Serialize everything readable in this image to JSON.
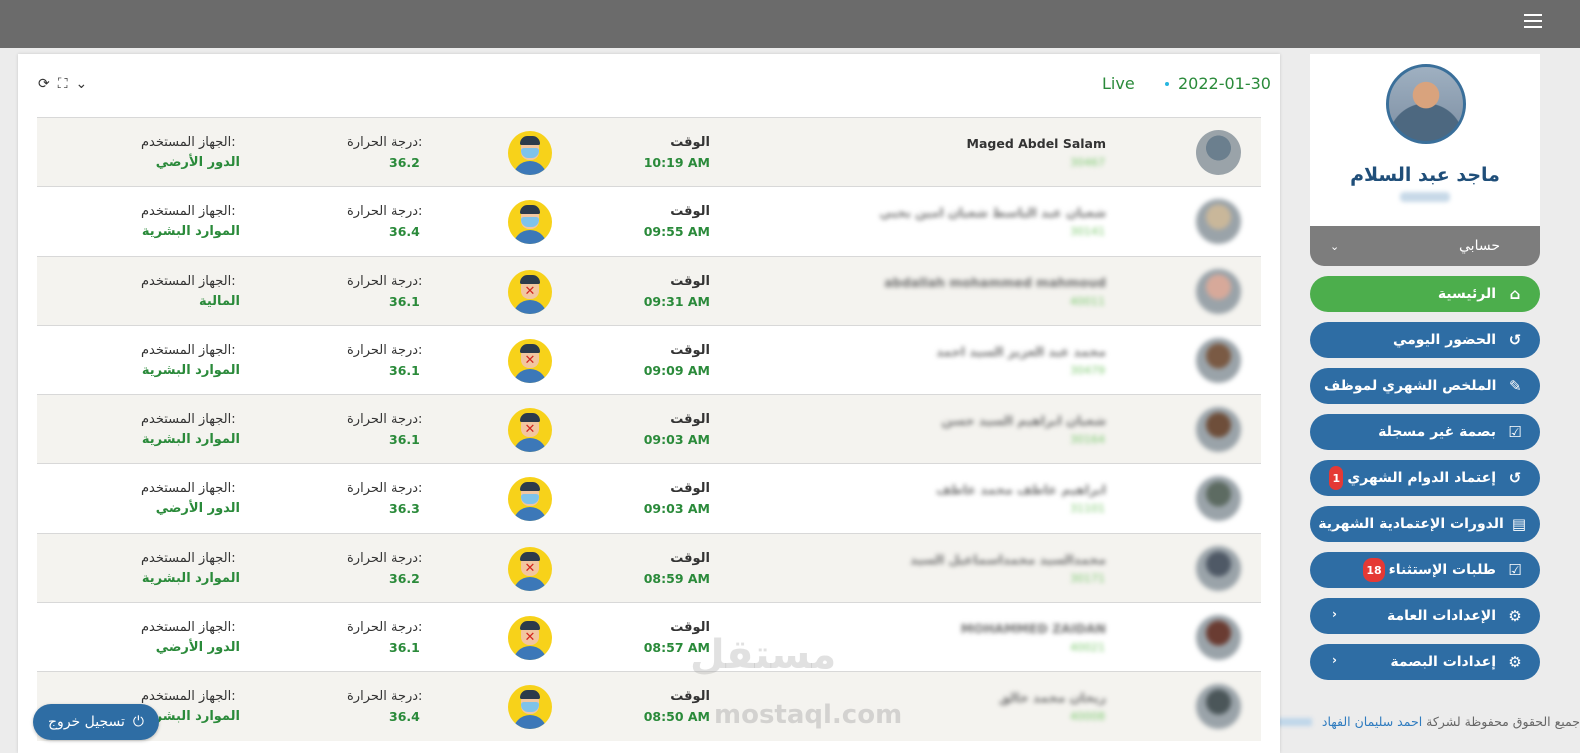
{
  "topbar": {
    "menu_icon": "hamburger-icon"
  },
  "profile": {
    "name": "ماجد عبد السلام",
    "account_label": "حسابي"
  },
  "menu": [
    {
      "label": "الرئيسية",
      "icon": "home-icon",
      "glyph": "⌂",
      "active": true
    },
    {
      "label": "الحضور اليومي",
      "icon": "history-icon",
      "glyph": "↺"
    },
    {
      "label": "الملخص الشهري لموظف",
      "icon": "document-edit-icon",
      "glyph": "✎"
    },
    {
      "label": "بصمة غير مسجلة",
      "icon": "checkbox-icon",
      "glyph": "☑"
    },
    {
      "label": "إعتماد الدوام الشهري",
      "icon": "history-icon",
      "glyph": "↺",
      "badge": "1"
    },
    {
      "label": "الدورات الإعتمادية الشهرية",
      "icon": "list-icon",
      "glyph": "▤"
    },
    {
      "label": "طلبات الإستثناء",
      "icon": "checkbox-icon",
      "glyph": "☑",
      "badge": "18"
    },
    {
      "label": "الإعدادات العامة",
      "icon": "cogs-icon",
      "glyph": "⚙",
      "chevron": "›"
    },
    {
      "label": "إعدادات البصمة",
      "icon": "cogs-icon",
      "glyph": "⚙",
      "chevron": "›"
    }
  ],
  "footer": {
    "rights_text": "جميع الحقوق محفوظة لشركة",
    "company": "احمد سليمان الفهاد"
  },
  "panel": {
    "date": "2022-01-30",
    "live_label": "Live",
    "controls": [
      "refresh-icon",
      "expand-icon",
      "chevron-down-icon"
    ]
  },
  "labels": {
    "time": "الوقت",
    "temperature": "درجة الحرارة:",
    "device": "الجهاز المستخدم:"
  },
  "attendance": [
    {
      "name": "Maged Abdel Salam",
      "id": "30467",
      "time": "10:19 AM",
      "temp": "36.2",
      "device": "الدور الأرضي",
      "mask": true,
      "avatar_color": "#6b7f8e"
    },
    {
      "name": "شعبان عبد الباسط شعبان امين بحبي",
      "id": "30141",
      "time": "09:55 AM",
      "temp": "36.4",
      "device": "الموارد البشرية",
      "mask": true,
      "avatar_color": "#c9b79a"
    },
    {
      "name": "abdallah mohammed mahmoud",
      "id": "40011",
      "time": "09:31 AM",
      "temp": "36.1",
      "device": "المالية",
      "mask": false,
      "avatar_color": "#d7a99a"
    },
    {
      "name": "محمد عبد العزيز السيد احمد",
      "id": "30479",
      "time": "09:09 AM",
      "temp": "36.1",
      "device": "الموارد البشرية",
      "mask": false,
      "avatar_color": "#7a5a44"
    },
    {
      "name": "شعبان ابراهيم السيد حسن",
      "id": "30164",
      "time": "09:03 AM",
      "temp": "36.1",
      "device": "الموارد البشرية",
      "mask": false,
      "avatar_color": "#6e4e3a"
    },
    {
      "name": "ابراهيم عاطف محمد عاطف",
      "id": "31101",
      "time": "09:03 AM",
      "temp": "36.3",
      "device": "الدور الأرضي",
      "mask": true,
      "avatar_color": "#5d6b62"
    },
    {
      "name": "محمدالسيد محمداسماعيل السيد",
      "id": "30171",
      "time": "08:59 AM",
      "temp": "36.2",
      "device": "الموارد البشرية",
      "mask": false,
      "avatar_color": "#4f5966"
    },
    {
      "name": "MOHAMMED ZAIDAN",
      "id": "40021",
      "time": "08:57 AM",
      "temp": "36.1",
      "device": "الدور الأرضي",
      "mask": false,
      "avatar_color": "#6a3c32"
    },
    {
      "name": "ريحان محمد خالق",
      "id": "40008",
      "time": "08:50 AM",
      "temp": "36.4",
      "device": "الموارد البشرية",
      "mask": true,
      "avatar_color": "#4b5659"
    }
  ],
  "watermark": {
    "text": "مستقل",
    "sub": "mostaql.com"
  },
  "logout": {
    "label": "تسجيل خروج",
    "icon": "power-icon"
  }
}
